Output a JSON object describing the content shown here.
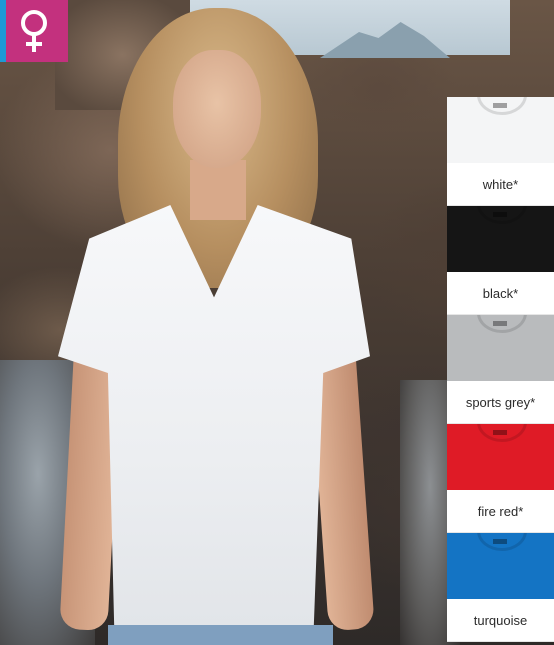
{
  "badge": {
    "icon": "female-symbol-icon",
    "background_color": "#c3317e",
    "stripe_color": "#1e9ad6"
  },
  "swatches": [
    {
      "label": "white*",
      "color": "#f4f5f6"
    },
    {
      "label": "black*",
      "color": "#151515"
    },
    {
      "label": "sports grey*",
      "color": "#b9bbbd"
    },
    {
      "label": "fire red*",
      "color": "#df1b26"
    },
    {
      "label": "turquoise",
      "color": "#1474c4"
    }
  ]
}
